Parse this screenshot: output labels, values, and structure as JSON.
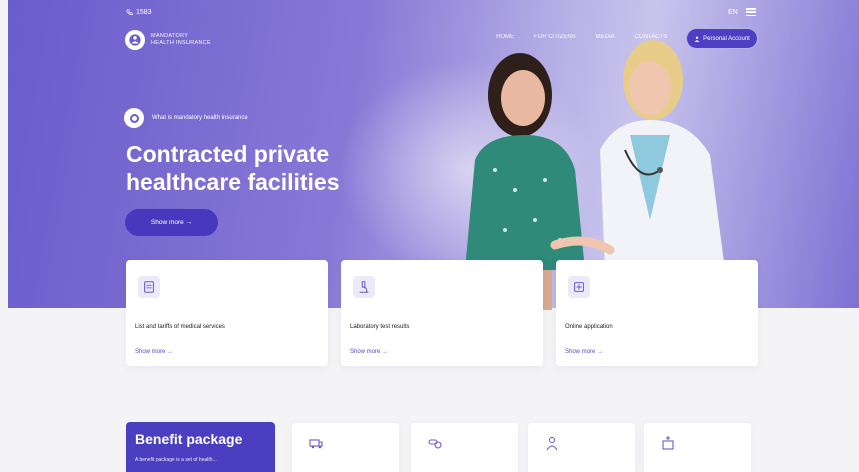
{
  "topbar": {
    "phone": "1583",
    "lang": "EN"
  },
  "logo": {
    "line1": "MANDATORY",
    "line2": "HEALTH INSURANCE"
  },
  "nav": {
    "items": [
      "HOME",
      "FOR CITIZENS",
      "MEDIA",
      "CONTACTS"
    ],
    "account_label": "Personal Account"
  },
  "hero": {
    "intro": "What is mandatory health insurance",
    "title": "Contracted private healthcare facilities",
    "button": "Show more →"
  },
  "cards": [
    {
      "icon": "document-icon",
      "title": "List and tariffs of medical services",
      "link": "Show more →"
    },
    {
      "icon": "microscope-icon",
      "title": "Laboratory test results",
      "link": "Show more →"
    },
    {
      "icon": "application-icon",
      "title": "Online application",
      "link": "Show more →"
    }
  ],
  "benefit": {
    "title": "Benefit package",
    "desc": "A benefit package is a set of health..."
  },
  "benefit_icons": [
    "ambulance-icon",
    "pills-icon",
    "doctor-icon",
    "hospital-icon"
  ],
  "colors": {
    "primary": "#4a3fc0",
    "hero_light": "#c8c4ec",
    "background": "#f4f4f6"
  }
}
